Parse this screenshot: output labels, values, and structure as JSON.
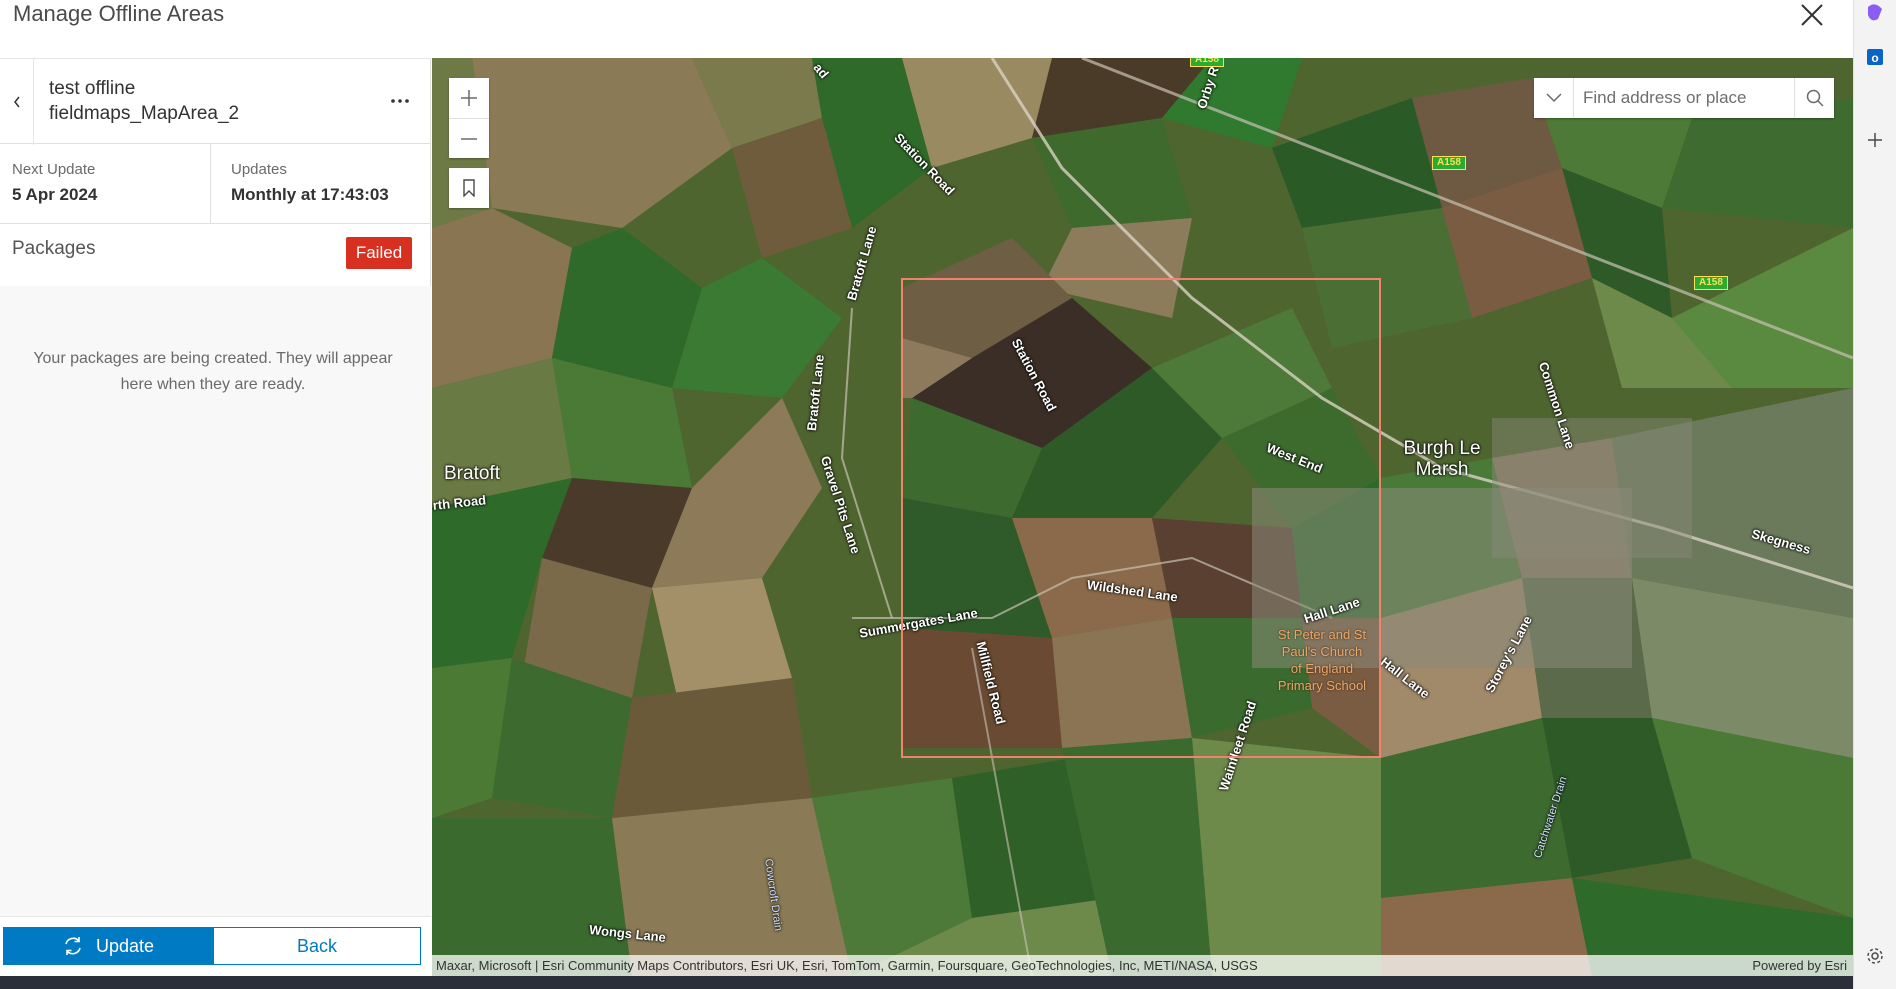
{
  "window": {
    "title": "Manage Offline Areas"
  },
  "area": {
    "name_line1": "test offline",
    "name_line2": "fieldmaps_MapArea_2"
  },
  "info": {
    "next_update_label": "Next Update",
    "next_update_value": "5 Apr 2024",
    "updates_label": "Updates",
    "updates_value": "Monthly at 17:43:03"
  },
  "packages": {
    "title": "Packages",
    "status": "Failed",
    "status_color": "#d83020",
    "message": "Your packages are being created. They will appear here when they are ready."
  },
  "footer": {
    "update_label": "Update",
    "back_label": "Back"
  },
  "map": {
    "search_placeholder": "Find address or place",
    "attribution": "Maxar, Microsoft | Esri Community Maps Contributors, Esri UK, Esri, TomTom, Garmin, Foursquare, GeoTechnologies, Inc, METI/NASA, USGS",
    "powered_by": "Powered by Esri",
    "offline_area_color": "#f0826e",
    "places": [
      "Bratoft",
      "Burgh Le Marsh"
    ],
    "roads": [
      "Station Road",
      "Bratoft Lane",
      "Bratoft Lane",
      "Station Road",
      "Gravel Pits Lane",
      "Summergates Lane",
      "Wildshed Lane",
      "West End",
      "Hall Lane",
      "Hall Lane",
      "Storey's Lane",
      "Common Lane",
      "Skegness",
      "Wainfleet Road",
      "Millfield Road",
      "Wongs Lane",
      "rth Road",
      "Orby R",
      "ad",
      "Cowcroft Drain",
      "Catchwater Drain"
    ],
    "poi": [
      "St Peter and St",
      "Paul's Church",
      "of England",
      "Primary School"
    ],
    "a_road_signs": [
      "A158",
      "A158",
      "A158"
    ]
  },
  "icons": {
    "close": "close-icon",
    "back": "chevron-left-icon",
    "more": "more-horizontal-icon",
    "update": "refresh-icon",
    "zoom_in": "plus-icon",
    "zoom_out": "minus-icon",
    "bookmark": "bookmark-icon",
    "search_dropdown": "caret-down-icon",
    "search": "search-icon"
  }
}
